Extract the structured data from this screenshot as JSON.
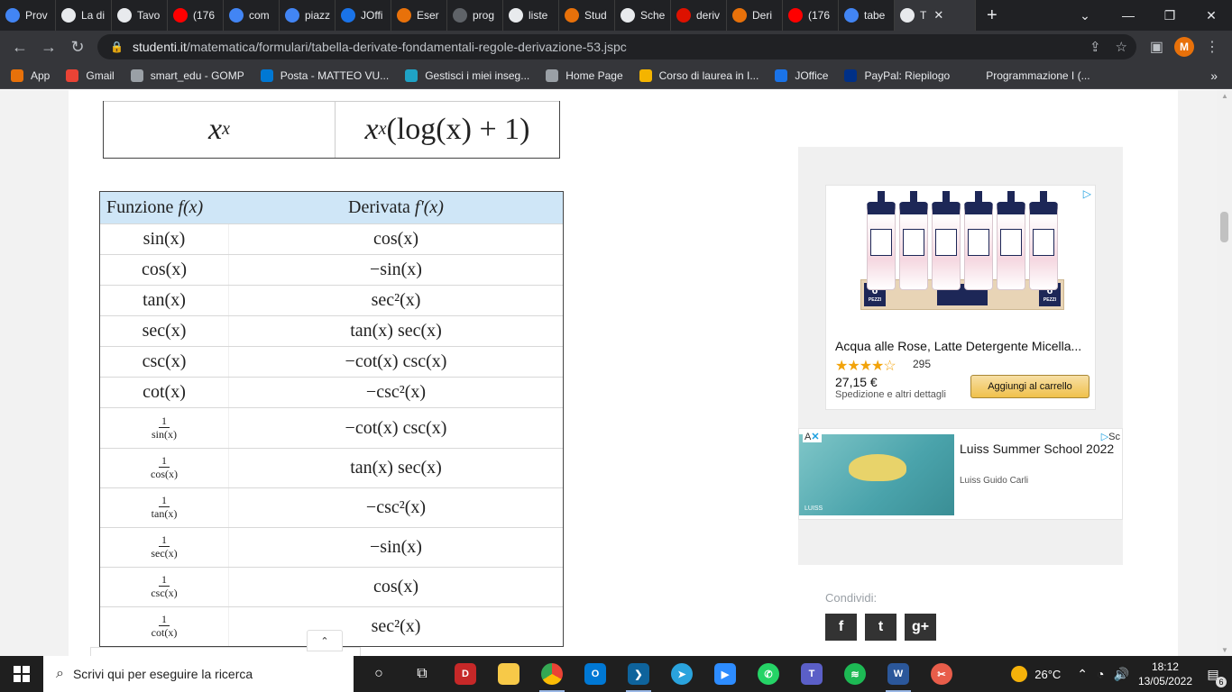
{
  "tabs": [
    {
      "label": "Prov",
      "icon": "chrome-icon",
      "color": "#4285f4"
    },
    {
      "label": "La di",
      "icon": "globe-icon",
      "color": "#e8eaed"
    },
    {
      "label": "Tavo",
      "icon": "studenti-icon",
      "color": "#e8eaed"
    },
    {
      "label": "(176",
      "icon": "youtube-icon",
      "color": "#ff0000"
    },
    {
      "label": "com",
      "icon": "google-icon",
      "color": "#4285f4"
    },
    {
      "label": "piazz",
      "icon": "google-icon",
      "color": "#4285f4"
    },
    {
      "label": "JOffi",
      "icon": "joffice-icon",
      "color": "#1a73e8"
    },
    {
      "label": "Eser",
      "icon": "pi-icon",
      "color": "#e8710a"
    },
    {
      "label": "prog",
      "icon": "github-icon",
      "color": "#5f6368"
    },
    {
      "label": "liste",
      "icon": "globe-icon",
      "color": "#e8eaed"
    },
    {
      "label": "Stud",
      "icon": "pi-icon",
      "color": "#e8710a"
    },
    {
      "label": "Sche",
      "icon": "globe-icon",
      "color": "#e8eaed"
    },
    {
      "label": "deriv",
      "icon": "wolfram-icon",
      "color": "#dd1100"
    },
    {
      "label": "Deri",
      "icon": "pi-icon",
      "color": "#e8710a"
    },
    {
      "label": "(176",
      "icon": "youtube-icon",
      "color": "#ff0000"
    },
    {
      "label": "tabe",
      "icon": "google-icon",
      "color": "#4285f4"
    },
    {
      "label": "T",
      "icon": "studenti-icon",
      "color": "#e8eaed"
    }
  ],
  "address": {
    "host": "studenti.it",
    "path": "/matematica/formulari/tabella-derivate-fondamentali-regole-derivazione-53.jspc"
  },
  "profile_initial": "M",
  "bookmarks": [
    {
      "label": "App",
      "icon": "apps-grid-icon",
      "color": "#e8710a"
    },
    {
      "label": "Gmail",
      "icon": "gmail-icon",
      "color": "#ea4335"
    },
    {
      "label": "smart_edu - GOMP",
      "icon": "globe-icon",
      "color": "#9aa0a6"
    },
    {
      "label": "Posta - MATTEO VU...",
      "icon": "outlook-icon",
      "color": "#0078d4"
    },
    {
      "label": "Gestisci i miei inseg...",
      "icon": "teach-icon",
      "color": "#1fa3c6"
    },
    {
      "label": "Home Page",
      "icon": "globe-icon",
      "color": "#9aa0a6"
    },
    {
      "label": "Corso di laurea in I...",
      "icon": "course-icon",
      "color": "#f4b400"
    },
    {
      "label": "JOffice",
      "icon": "joffice-icon",
      "color": "#1a73e8"
    },
    {
      "label": "PayPal: Riepilogo",
      "icon": "paypal-icon",
      "color": "#003087"
    },
    {
      "label": "Programmazione I (...",
      "icon": "blank-icon",
      "color": "#35363a"
    }
  ],
  "top_row": {
    "f": "x",
    "f_exp": "x",
    "d_base": "x",
    "d_exp": "x",
    "d_rest": " (log(x) + 1)"
  },
  "table": {
    "header_f": "Funzione ",
    "header_f_math": "f(x)",
    "header_d": "Derivata ",
    "header_d_math": "f'(x)",
    "rows": [
      {
        "f": "sin(x)",
        "d": "cos(x)",
        "h": 34
      },
      {
        "f": "cos(x)",
        "d": "−sin(x)",
        "h": 34
      },
      {
        "f": "tan(x)",
        "d": "sec²(x)",
        "h": 34
      },
      {
        "f": "sec(x)",
        "d": "tan(x) sec(x)",
        "h": 34
      },
      {
        "f": "csc(x)",
        "d": "−cot(x) csc(x)",
        "h": 34
      },
      {
        "f": "cot(x)",
        "d": "−csc²(x)",
        "h": 34
      },
      {
        "frac_num": "1",
        "frac_den": "sin(x)",
        "d": "−cot(x) csc(x)",
        "h": 45
      },
      {
        "frac_num": "1",
        "frac_den": "cos(x)",
        "d": "tan(x) sec(x)",
        "h": 44
      },
      {
        "frac_num": "1",
        "frac_den": "tan(x)",
        "d": "−csc²(x)",
        "h": 44
      },
      {
        "frac_num": "1",
        "frac_den": "sec(x)",
        "d": "−sin(x)",
        "h": 44
      },
      {
        "frac_num": "1",
        "frac_den": "csc(x)",
        "d": "cos(x)",
        "h": 44
      },
      {
        "frac_num": "1",
        "frac_den": "cot(x)",
        "d": "sec²(x)",
        "h": 44
      }
    ]
  },
  "ad1": {
    "title": "Acqua alle Rose, Latte Detergente Micella...",
    "rating_stars": "★★★★☆",
    "rating_count": "295",
    "price": "27,15 €",
    "shipping": "Spedizione e altri dettagli",
    "cart_button": "Aggiungi al carrello",
    "pack_count": "6",
    "pack_label": "PEZZI"
  },
  "ad2": {
    "title": "Luiss Summer School 2022",
    "subtitle": "Luiss Guido Carli",
    "brand": "LUISS",
    "ad_label": "A",
    "choices_label": "Sc"
  },
  "share": {
    "label": "Condividi:",
    "buttons": [
      "f",
      "t",
      "g+"
    ]
  },
  "taskbar": {
    "search_placeholder": "Scrivi qui per eseguire la ricerca",
    "temperature": "26°C",
    "time": "18:12",
    "date": "13/05/2022",
    "notifications": "6"
  }
}
